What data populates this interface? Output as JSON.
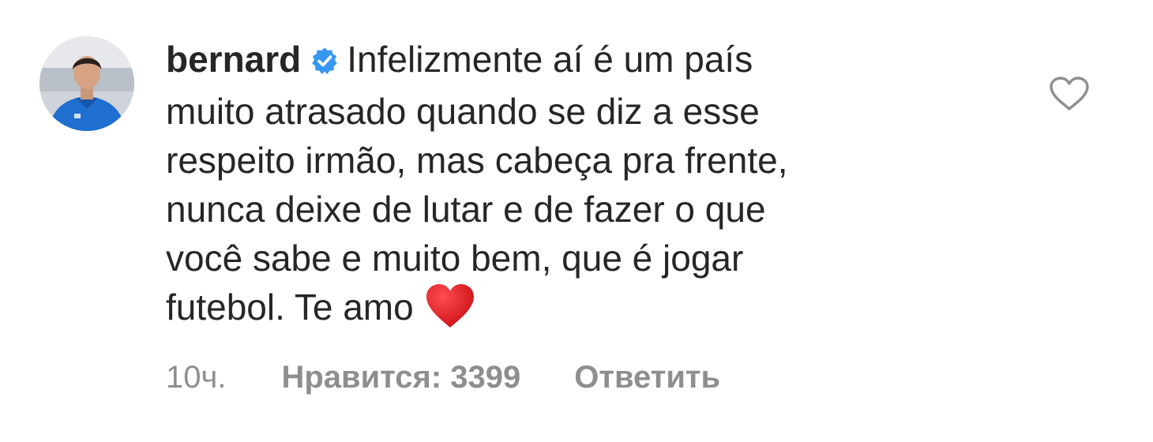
{
  "comment": {
    "username": "bernard",
    "verified_icon": "verified-badge-icon",
    "text": "Infelizmente aí é um país\nmuito atrasado quando se diz a esse\nrespeito irmão, mas cabeça pra frente,\nnunca deixe de lutar e de fazer o que\nvocê sabe e muito bem, que é jogar\nfutebol. Te amo",
    "emoji": "red-heart-icon",
    "time": "10ч.",
    "likes": "Нравится: 3399",
    "reply_label": "Ответить",
    "like_icon": "heart-outline-icon"
  },
  "colors": {
    "text": "#262626",
    "meta": "#8e8e8e",
    "verified": "#3897f0",
    "heart_red": "#e0151b"
  }
}
